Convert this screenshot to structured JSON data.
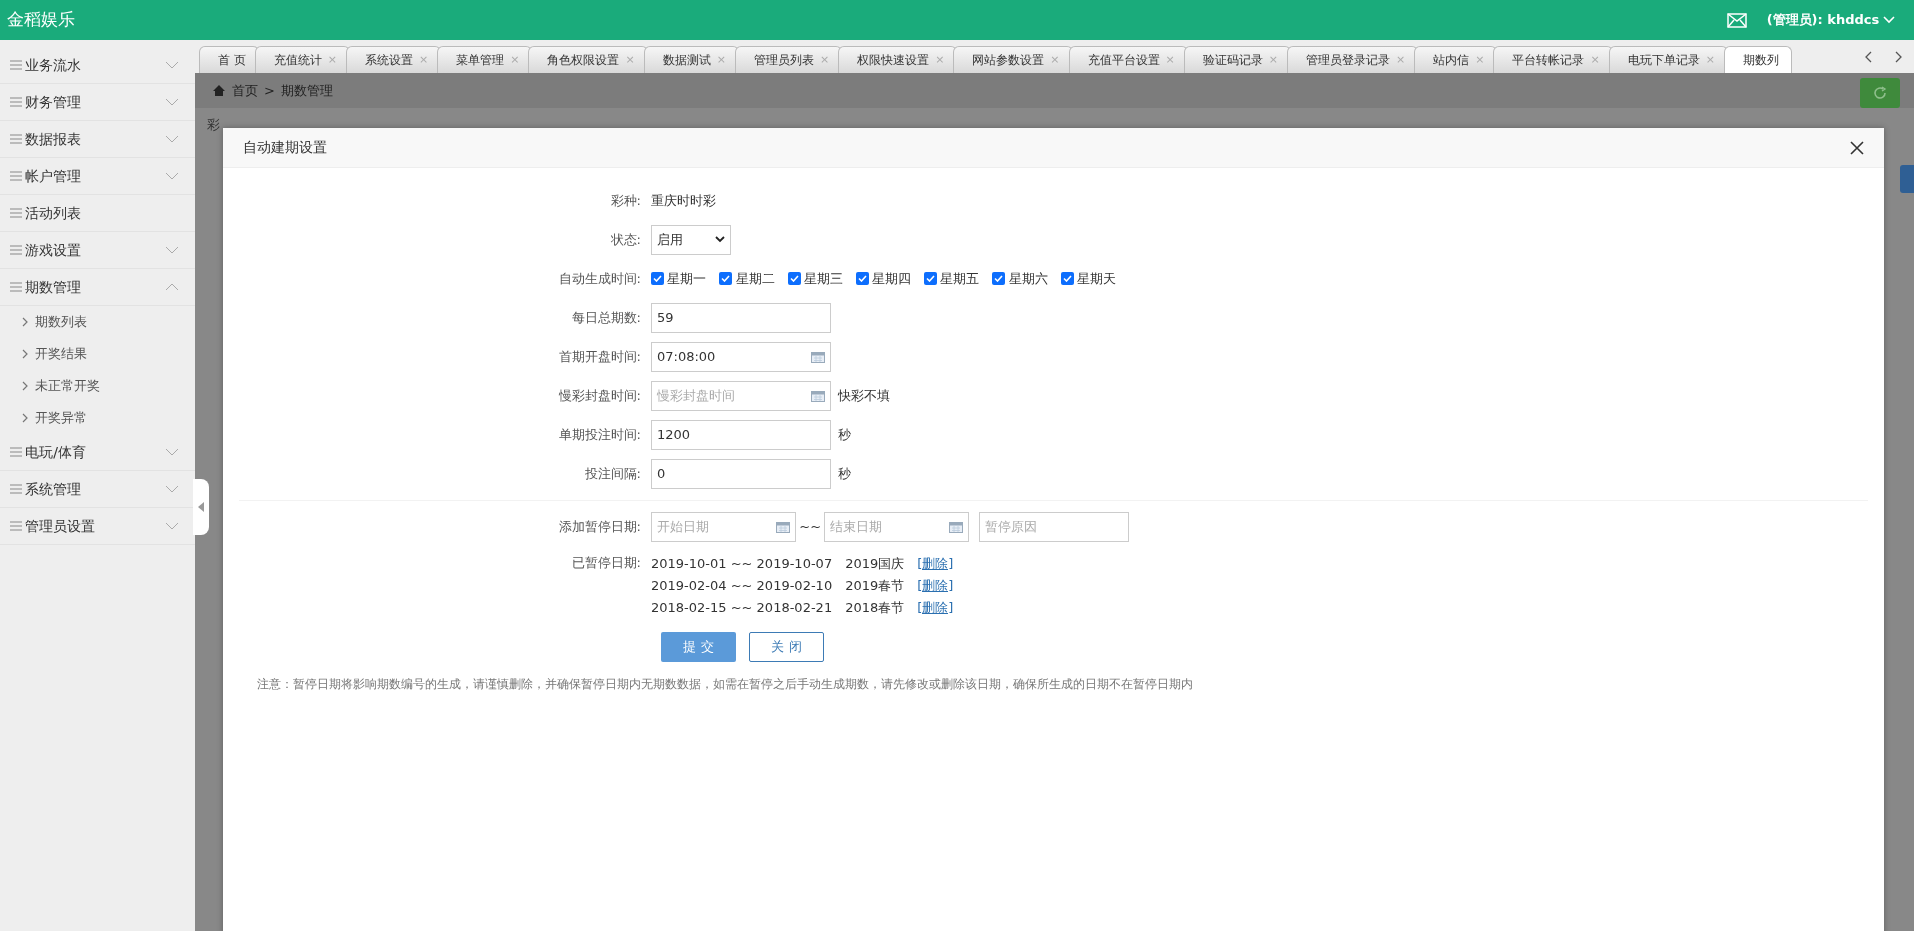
{
  "header": {
    "logo": "金稻娱乐",
    "user": "(管理员): khddcs"
  },
  "sidebar": {
    "items": [
      {
        "label": "业务流水",
        "expanded": false
      },
      {
        "label": "财务管理",
        "expanded": false
      },
      {
        "label": "数据报表",
        "expanded": false
      },
      {
        "label": "帐户管理",
        "expanded": false
      },
      {
        "label": "活动列表"
      },
      {
        "label": "游戏设置",
        "expanded": false
      },
      {
        "label": "期数管理",
        "expanded": true,
        "children": [
          {
            "label": "期数列表"
          },
          {
            "label": "开奖结果"
          },
          {
            "label": "未正常开奖"
          },
          {
            "label": "开奖异常"
          }
        ]
      },
      {
        "label": "电玩/体育",
        "expanded": false
      },
      {
        "label": "系统管理",
        "expanded": false
      },
      {
        "label": "管理员设置",
        "expanded": false
      }
    ]
  },
  "tabs": [
    {
      "label": "首 页",
      "selected": false
    },
    {
      "label": "充值统计",
      "close": "×",
      "selected": false
    },
    {
      "label": "系统设置",
      "close": "×",
      "selected": false
    },
    {
      "label": "菜单管理",
      "close": "×",
      "selected": false
    },
    {
      "label": "角色权限设置",
      "close": "×",
      "selected": false
    },
    {
      "label": "数据测试",
      "close": "×",
      "selected": false
    },
    {
      "label": "管理员列表",
      "close": "×",
      "selected": false
    },
    {
      "label": "权限快速设置",
      "close": "×",
      "selected": false
    },
    {
      "label": "网站参数设置",
      "close": "×",
      "selected": false
    },
    {
      "label": "充值平台设置",
      "close": "×",
      "selected": false
    },
    {
      "label": "验证码记录",
      "close": "×",
      "selected": false
    },
    {
      "label": "管理员登录记录",
      "close": "×",
      "selected": false
    },
    {
      "label": "站内信",
      "close": "×",
      "selected": false
    },
    {
      "label": "平台转帐记录",
      "close": "×",
      "selected": false
    },
    {
      "label": "电玩下单记录",
      "close": "×",
      "selected": false
    },
    {
      "label": "期数列",
      "selected": true
    }
  ],
  "breadcrumb": {
    "items": [
      "首页",
      "期数管理"
    ],
    "separator": ">"
  },
  "background_text": "彩",
  "modal": {
    "title": "自动建期设置",
    "fields": [
      {
        "kind": "text",
        "label": "彩种:",
        "value": "重庆时时彩"
      },
      {
        "kind": "select",
        "label": "状态:",
        "value": "启用"
      },
      {
        "kind": "days",
        "label": "自动生成时间:",
        "days": [
          {
            "label": "星期一",
            "checked": true
          },
          {
            "label": "星期二",
            "checked": true
          },
          {
            "label": "星期三",
            "checked": true
          },
          {
            "label": "星期四",
            "checked": true
          },
          {
            "label": "星期五",
            "checked": true
          },
          {
            "label": "星期六",
            "checked": true
          },
          {
            "label": "星期天",
            "checked": true
          }
        ]
      },
      {
        "kind": "input",
        "label": "每日总期数:",
        "value": "59"
      },
      {
        "kind": "date",
        "label": "首期开盘时间:",
        "value": "07:08:00"
      },
      {
        "kind": "date",
        "label": "慢彩封盘时间:",
        "placeholder": "慢彩封盘时间",
        "suffix": "快彩不填"
      },
      {
        "kind": "input",
        "label": "单期投注时间:",
        "value": "1200",
        "suffix": "秒"
      },
      {
        "kind": "input",
        "label": "投注间隔:",
        "value": "0",
        "suffix": "秒"
      }
    ],
    "pause_form": {
      "label": "添加暂停日期:",
      "start_placeholder": "开始日期",
      "separator": "~~",
      "end_placeholder": "结束日期",
      "reason_placeholder": "暂停原因"
    },
    "paused": {
      "label": "已暂停日期:",
      "rows": [
        {
          "range": "2019-10-01 ~~ 2019-10-07",
          "reason": "2019国庆",
          "action": "[删除]"
        },
        {
          "range": "2019-02-04 ~~ 2019-02-10",
          "reason": "2019春节",
          "action": "[删除]"
        },
        {
          "range": "2018-02-15 ~~ 2018-02-21",
          "reason": "2018春节",
          "action": "[删除]"
        }
      ]
    },
    "buttons": [
      {
        "label": "提 交",
        "kind": "primary"
      },
      {
        "label": "关 闭",
        "kind": "outline"
      }
    ],
    "note": "注意：暂停日期将影响期数编号的生成，请谨慎删除，并确保暂停日期内无期数数据，如需在暂停之后手动生成期数，请先修改或删除该日期，确保所生成的日期不在暂停日期内"
  }
}
